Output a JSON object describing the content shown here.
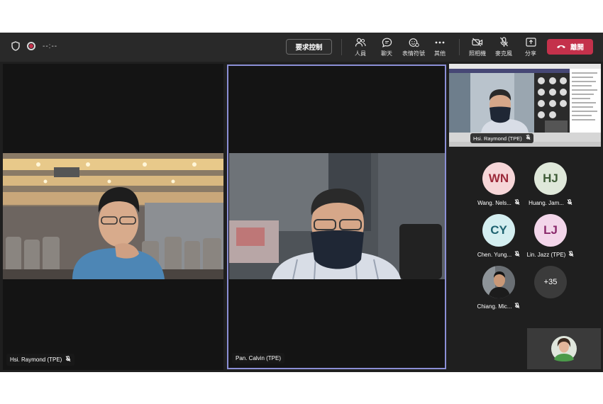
{
  "topbar": {
    "timer": "--:--",
    "control_button": "要求控制",
    "tools": [
      {
        "icon": "people-icon",
        "label": "人員"
      },
      {
        "icon": "chat-icon",
        "label": "聊天"
      },
      {
        "icon": "reactions-icon",
        "label": "表情符號"
      },
      {
        "icon": "more-icon",
        "label": "其他"
      },
      {
        "icon": "camera-off-icon",
        "label": "照相機"
      },
      {
        "icon": "mic-off-icon",
        "label": "麥克風"
      },
      {
        "icon": "share-icon",
        "label": "分享"
      }
    ],
    "leave_button": "離開"
  },
  "tiles": {
    "left_name": "Hsi. Raymond (TPE)",
    "mid_name": "Pan. Calvin (TPE)"
  },
  "share_preview": {
    "name": "Hsi. Raymond (TPE)"
  },
  "roster": [
    {
      "initials": "WN",
      "name": "Wang. Nels...",
      "bg": "#f6d6d8",
      "fg": "#9c2a3a"
    },
    {
      "initials": "HJ",
      "name": "Huang. Jam...",
      "bg": "#dfe8da",
      "fg": "#3d5a36"
    },
    {
      "initials": "CY",
      "name": "Chen. Yung...",
      "bg": "#d4eef0",
      "fg": "#1e6270"
    },
    {
      "initials": "LJ",
      "name": "Lin. Jazz (TPE)",
      "bg": "#f3d6ea",
      "fg": "#8a2a6c"
    },
    {
      "initials": "",
      "name": "Chiang. Mic...",
      "bg": "#5a5a5a",
      "fg": "#ffffff"
    },
    {
      "initials": "+35",
      "name": "",
      "bg": "#3b3b3b",
      "fg": "#ffffff"
    }
  ],
  "colors": {
    "accent": "#8b8fd6",
    "leave": "#c4314b",
    "background": "#1f1f1f"
  }
}
